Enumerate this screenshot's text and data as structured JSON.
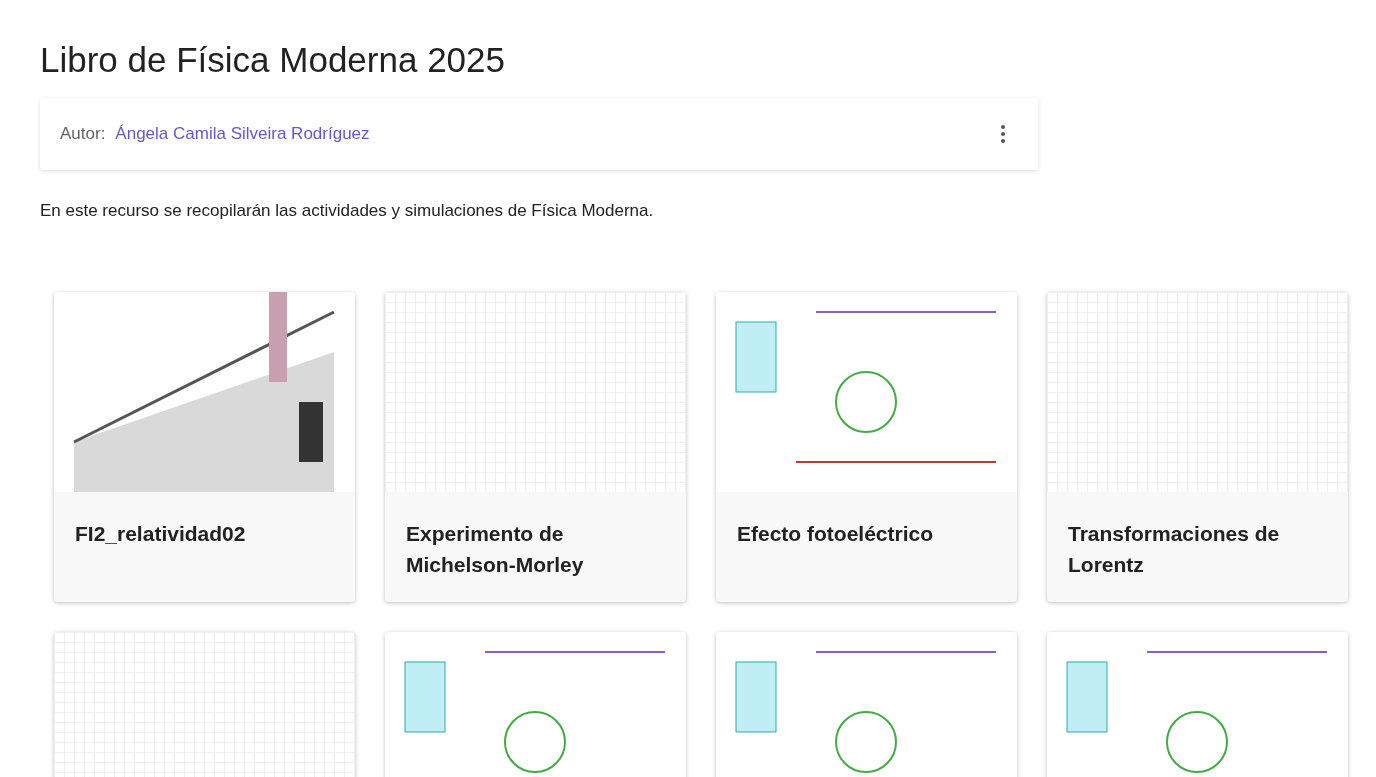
{
  "page": {
    "title": "Libro de Física Moderna 2025"
  },
  "author": {
    "label": "Autor:",
    "name": "Ángela Camila Silveira Rodríguez"
  },
  "description": "En este recurso se recopilarán las actividades y simulaciones de Física Moderna.",
  "cards": [
    {
      "kind": "illustration",
      "title": "FI2_relatividad02"
    },
    {
      "kind": "grid",
      "title": "Experimento de Michelson-Morley"
    },
    {
      "kind": "plain",
      "title": "Efecto fotoeléctrico"
    },
    {
      "kind": "grid",
      "title": "Transformaciones de Lorentz"
    },
    {
      "kind": "grid"
    },
    {
      "kind": "plain"
    },
    {
      "kind": "plain"
    },
    {
      "kind": "plain"
    }
  ]
}
